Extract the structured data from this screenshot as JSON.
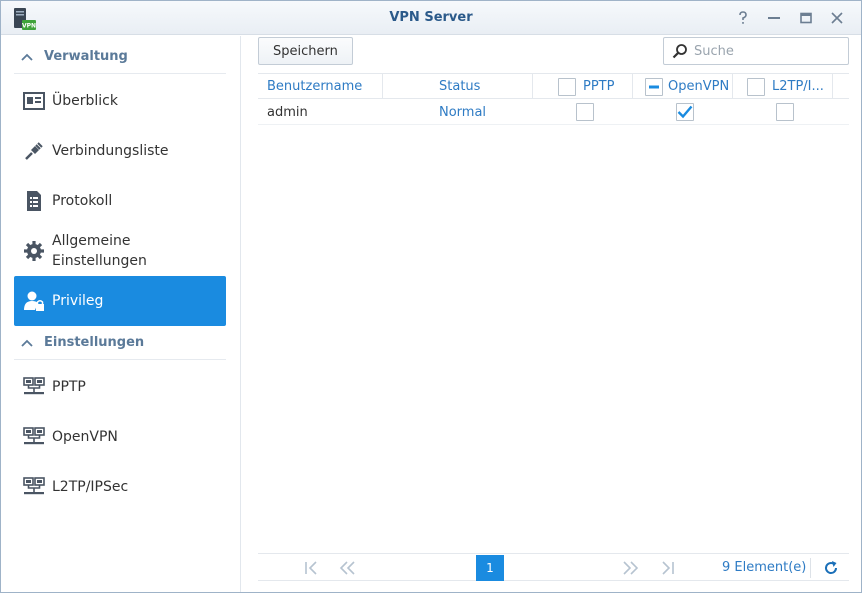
{
  "window": {
    "title": "VPN Server",
    "app_icon_label": "VPN",
    "controls": [
      "help",
      "minimize",
      "maximize",
      "close"
    ]
  },
  "sidebar": {
    "sections": [
      {
        "label": "Verwaltung",
        "items": [
          {
            "label": "Überblick",
            "icon": "overview-icon"
          },
          {
            "label": "Verbindungsliste",
            "icon": "connection-list-icon"
          },
          {
            "label": "Protokoll",
            "icon": "log-icon"
          },
          {
            "label_line1": "Allgemeine",
            "label_line2": "Einstellungen",
            "icon": "gear-icon"
          },
          {
            "label": "Privileg",
            "icon": "privilege-icon",
            "active": true
          }
        ]
      },
      {
        "label": "Einstellungen",
        "items": [
          {
            "label": "PPTP",
            "icon": "network-icon"
          },
          {
            "label": "OpenVPN",
            "icon": "network-icon"
          },
          {
            "label": "L2TP/IPSec",
            "icon": "network-icon"
          }
        ]
      }
    ]
  },
  "toolbar": {
    "save_label": "Speichern",
    "search_placeholder": "Suche"
  },
  "table": {
    "columns": {
      "username": "Benutzername",
      "status": "Status",
      "pptp": "PPTP",
      "openvpn": "OpenVPN",
      "l2tp": "L2TP/I..."
    },
    "header_checkbox_state": {
      "pptp": "unchecked",
      "openvpn": "partial",
      "l2tp": "unchecked"
    },
    "rows": [
      {
        "username": "admin",
        "status": "Normal",
        "pptp": false,
        "openvpn": true,
        "l2tp": false
      }
    ]
  },
  "pager": {
    "current_page": "1",
    "count_text": "9 Element(e)"
  },
  "colors": {
    "accent": "#1a8be0",
    "link_blue": "#2e7bc4",
    "section_gray": "#5b7a99"
  }
}
